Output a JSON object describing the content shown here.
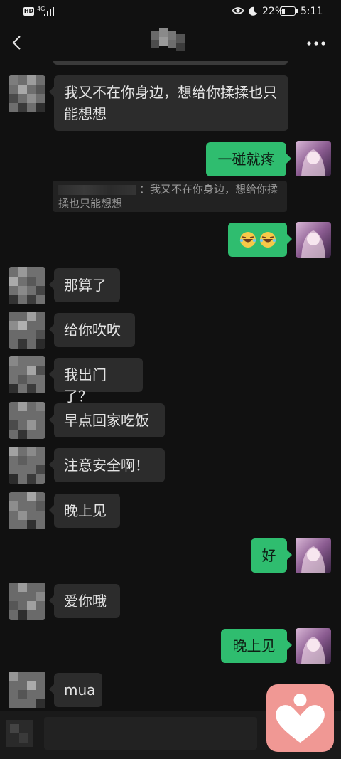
{
  "status_bar": {
    "hd": "HD",
    "network": "4G",
    "battery": "22%",
    "time": "5:11"
  },
  "header": {
    "back_icon": "chevron-left-icon",
    "more_icon": "more-dots-icon"
  },
  "messages": [
    {
      "side": "left",
      "text": "我又不在你身边，想给你揉揉也只能想想"
    },
    {
      "side": "right",
      "text": "一碰就疼"
    },
    {
      "side": "quote",
      "text": "：我又不在你身边，想给你揉揉也只能想想"
    },
    {
      "side": "right",
      "text": "",
      "emoji": [
        "laugh-cry-emoji",
        "laugh-cry-emoji"
      ]
    },
    {
      "side": "left",
      "text": "那算了"
    },
    {
      "side": "left",
      "text": "给你吹吹"
    },
    {
      "side": "left",
      "text": "我出门了？"
    },
    {
      "side": "left",
      "text": "早点回家吃饭"
    },
    {
      "side": "left",
      "text": "注意安全啊！"
    },
    {
      "side": "left",
      "text": "晚上见"
    },
    {
      "side": "right",
      "text": "好"
    },
    {
      "side": "left",
      "text": "爱你哦"
    },
    {
      "side": "right",
      "text": "晚上见"
    },
    {
      "side": "left",
      "text": "mua"
    }
  ],
  "colors": {
    "background": "#111111",
    "bubble_right": "#2fbd6f",
    "bubble_left": "#2c2c2c",
    "heart_button": "#f09894"
  },
  "floating": {
    "icon": "heart-person-icon"
  }
}
